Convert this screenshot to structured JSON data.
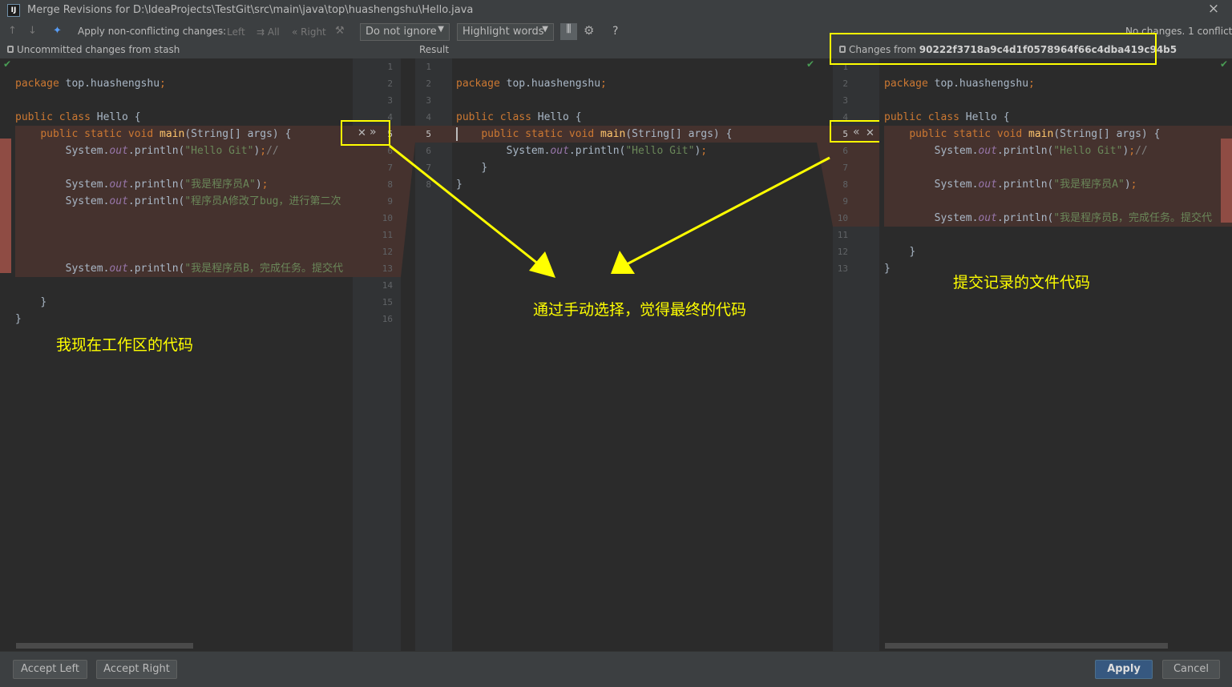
{
  "window": {
    "title": "Merge Revisions for D:\\IdeaProjects\\TestGit\\src\\main\\java\\top\\huashengshu\\Hello.java",
    "close": "×"
  },
  "toolbar": {
    "apply_label": "Apply non-conflicting changes:",
    "left": "Left",
    "all": "All",
    "right": "Right",
    "whitespace": "Do not ignore",
    "highlight": "Highlight words",
    "help": "?",
    "status": "No changes. 1 conflict"
  },
  "headers": {
    "left": "Uncommitted changes from stash",
    "result": "Result",
    "right_prefix": "Changes from",
    "right_hash": "90222f3718a9c4d1f0578964f66c4dba419c94b5"
  },
  "left_gutter_numbers": [
    "1",
    "2",
    "3",
    "4",
    "5",
    "6",
    "7",
    "8",
    "9",
    "10",
    "11",
    "12",
    "13",
    "14",
    "15",
    "16"
  ],
  "result_numbers": [
    "1",
    "2",
    "3",
    "4",
    "5",
    "6",
    "7",
    "8"
  ],
  "right_numbers": [
    "1",
    "2",
    "3",
    "4",
    "5",
    "6",
    "7",
    "8",
    "9",
    "10",
    "11",
    "12",
    "13"
  ],
  "annotations": {
    "left": "我现在工作区的代码",
    "middle": "通过手动选择，觉得最终的代码",
    "right": "提交记录的文件代码"
  },
  "code": {
    "pkg_kw": "package",
    "pkg_name": " top.huashengshu",
    "semi": ";",
    "cls_kw": "public class",
    "cls_name": " Hello {",
    "main_kw": "public static void",
    "main_fn": "main",
    "main_args": "(String[] args) {",
    "sys": "System.",
    "out": "out",
    "println": ".println(",
    "hello": "\"Hello Git\"",
    "close_paren": ")",
    "comment": "//",
    "str_a": "\"我是程序员A\"",
    "str_a2": "\"程序员A修改了bug，进行第二次",
    "str_b": "\"我是程序员B，完成任务。提交代",
    "str_b2": "\"我是程序员B，完成任务。提交代",
    "brace": "}"
  },
  "buttons": {
    "accept_left": "Accept Left",
    "accept_right": "Accept Right",
    "apply": "Apply",
    "cancel": "Cancel"
  }
}
